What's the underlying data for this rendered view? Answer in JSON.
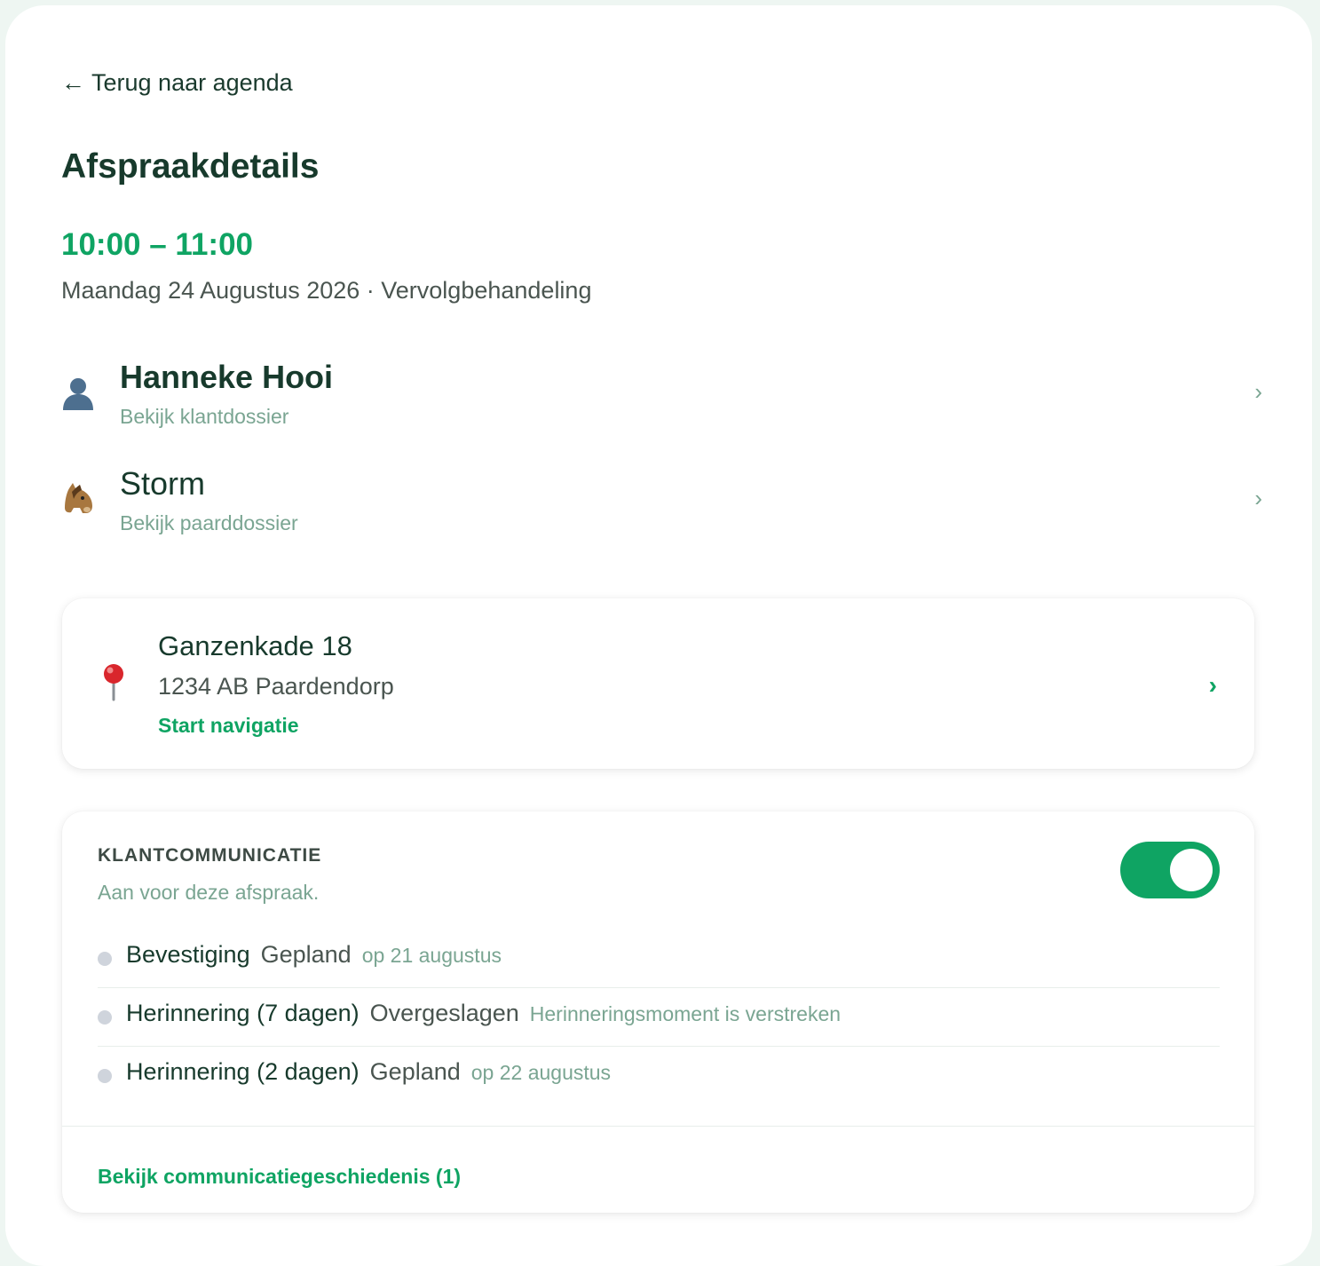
{
  "back_link": "← Terug naar agenda",
  "page_title": "Afspraakdetails",
  "appointment": {
    "time": "10:00 – 11:00",
    "subtitle": "Maandag 24 Augustus 2026 · Vervolgbehandeling"
  },
  "client": {
    "icon": "person-icon",
    "name": "Hanneke Hooi",
    "link": "Bekijk klantdossier"
  },
  "horse": {
    "icon": "horse-icon",
    "name": "Storm",
    "link": "Bekijk paarddossier"
  },
  "chevron": "›",
  "address": {
    "icon": "map-pin-icon",
    "street": "Ganzenkade 18",
    "city": "1234 AB Paardendorp",
    "navigate": "Start navigatie"
  },
  "communication": {
    "label": "KLANTCOMMUNICATIE",
    "status": "Aan voor deze afspraak.",
    "enabled": true,
    "accent_color": "#0fa463",
    "messages": [
      {
        "type": "Bevestiging",
        "state": "Gepland",
        "note": "op 21 augustus"
      },
      {
        "type": "Herinnering (7 dagen)",
        "state": "Overgeslagen",
        "note": "Herinneringsmoment is verstreken"
      },
      {
        "type": "Herinnering (2 dagen)",
        "state": "Gepland",
        "note": "op 22 augustus"
      }
    ],
    "history_link": "Bekijk communicatiegeschiedenis (1)"
  }
}
